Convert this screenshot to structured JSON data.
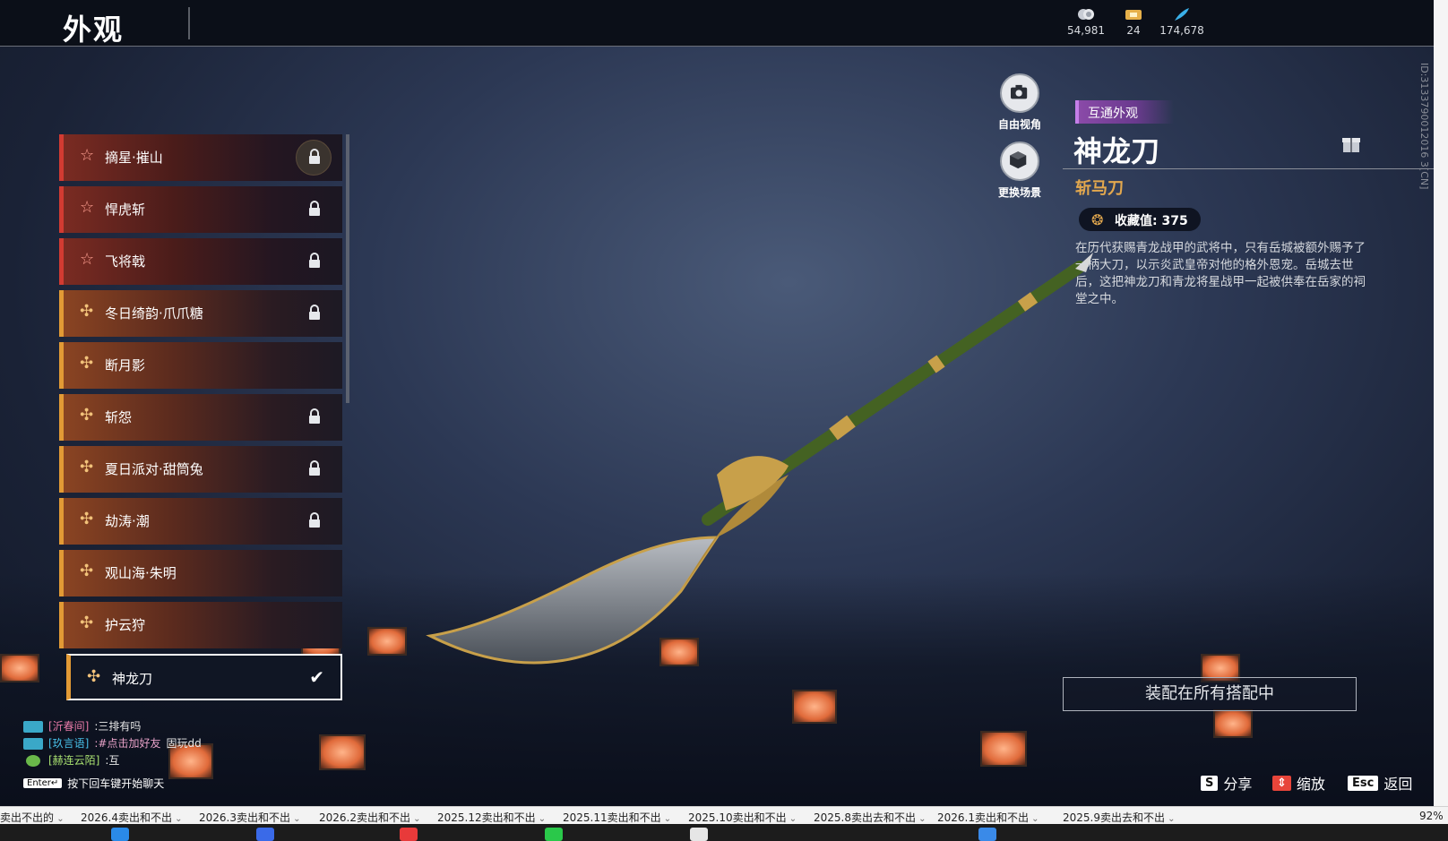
{
  "header": {
    "title": "外观",
    "currencies": [
      {
        "icon": "coin-icon",
        "value": "54,981"
      },
      {
        "icon": "ticket-icon",
        "value": "24"
      },
      {
        "icon": "feather-icon",
        "value": "174,678"
      }
    ]
  },
  "list": {
    "items": [
      {
        "label": "摘星·摧山",
        "icon": "star-icon",
        "locked": true
      },
      {
        "label": "悍虎斩",
        "icon": "star-icon",
        "locked": true
      },
      {
        "label": "飞将戟",
        "icon": "star-icon",
        "locked": true
      },
      {
        "label": "冬日绮韵·爪爪糖",
        "icon": "cross-icon",
        "locked": true
      },
      {
        "label": "断月影",
        "icon": "cross-icon",
        "locked": false
      },
      {
        "label": "斩怨",
        "icon": "cross-icon",
        "locked": true
      },
      {
        "label": "夏日派对·甜筒兔",
        "icon": "cross-icon",
        "locked": true
      },
      {
        "label": "劫涛·潮",
        "icon": "cross-icon",
        "locked": true
      },
      {
        "label": "观山海·朱明",
        "icon": "cross-icon",
        "locked": false
      },
      {
        "label": "护云狩",
        "icon": "cross-icon",
        "locked": false
      },
      {
        "label": "神龙刀",
        "icon": "cross-icon",
        "locked": false,
        "selected": true
      }
    ]
  },
  "side_buttons": {
    "free_view": "自由视角",
    "change_scene": "更换场景"
  },
  "detail": {
    "tag": "互通外观",
    "name": "神龙刀",
    "type": "斩马刀",
    "collection_label": "收藏值:",
    "collection_value": "375",
    "description": "在历代获赐青龙战甲的武将中，只有岳城被额外赐予了一柄大刀，以示炎武皇帝对他的格外恩宠。岳城去世后，这把神龙刀和青龙将星战甲一起被供奉在岳家的祠堂之中。",
    "equip_all": "装配在所有搭配中"
  },
  "hints": [
    {
      "key": "S",
      "label": "分享"
    },
    {
      "key": "⇕",
      "label": "缩放"
    },
    {
      "key": "Esc",
      "label": "返回"
    }
  ],
  "chat": {
    "lines": [
      {
        "channel": "[沂春间]",
        "message": ":三排有吗"
      },
      {
        "channel": "[玖言语]",
        "link": ":#点击加好友",
        "message": "固玩dd"
      },
      {
        "channel": "[赫连云陌]",
        "message": ":互"
      }
    ],
    "enter_key": "Enter↵",
    "enter_hint": "按下回车键开始聊天"
  },
  "id_text": "ID:3133790012016 3[CN]",
  "sheet_tabs": [
    "卖出不出的",
    "2026.4卖出和不出",
    "2026.3卖出和不出",
    "2026.2卖出和不出",
    "2025.12卖出和不出",
    "2025.11卖出和不出",
    "2025.10卖出和不出",
    "2025.8卖出去和不出",
    "2026.1卖出和不出",
    "2025.9卖出去和不出"
  ],
  "zoom": "92%",
  "colors": {
    "accent_red": "#d23b32",
    "accent_gold": "#e29a35",
    "tag_purple": "#8a4aa8",
    "type_gold": "#e3a84e"
  }
}
